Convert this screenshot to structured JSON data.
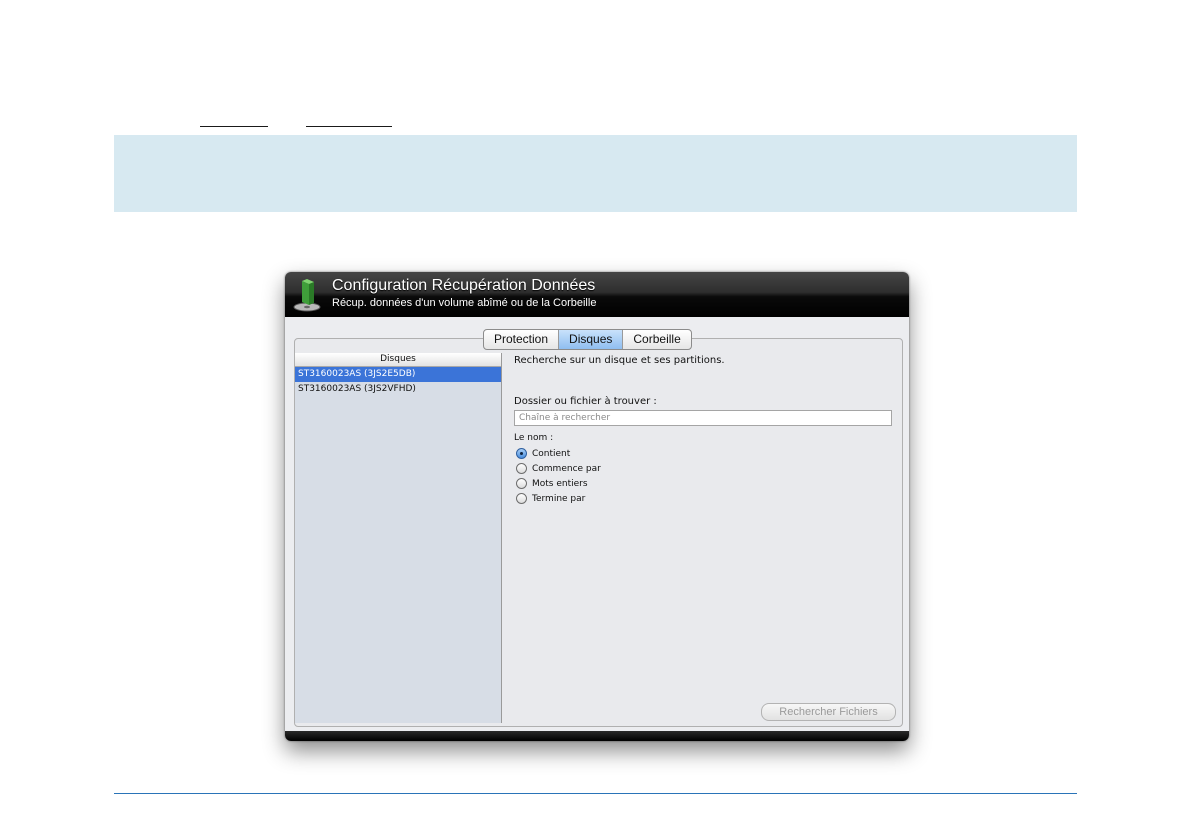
{
  "window": {
    "title": "Configuration Récupération Données",
    "subtitle": "Récup. données d'un volume abîmé ou de la Corbeille"
  },
  "tabs": [
    {
      "label": "Protection",
      "active": false
    },
    {
      "label": "Disques",
      "active": true
    },
    {
      "label": "Corbeille",
      "active": false
    }
  ],
  "disk_list": {
    "header": "Disques",
    "items": [
      {
        "label": "ST3160023AS (3JS2E5DB)",
        "selected": true
      },
      {
        "label": "ST3160023AS (3JS2VFHD)",
        "selected": false
      }
    ]
  },
  "search": {
    "description": "Recherche sur un disque et ses partitions.",
    "field_label": "Dossier ou fichier à trouver :",
    "placeholder": "Chaîne à rechercher",
    "value": "",
    "match_label": "Le nom :",
    "options": [
      {
        "label": "Contient",
        "selected": true
      },
      {
        "label": "Commence par",
        "selected": false
      },
      {
        "label": "Mots entiers",
        "selected": false
      },
      {
        "label": "Termine par",
        "selected": false
      }
    ],
    "button_label": "Rechercher Fichiers"
  },
  "colors": {
    "info_band": "#d7e9f1",
    "footer_rule": "#2a74b8",
    "selection": "#3b74d8",
    "active_tab": "#8fbef0"
  }
}
